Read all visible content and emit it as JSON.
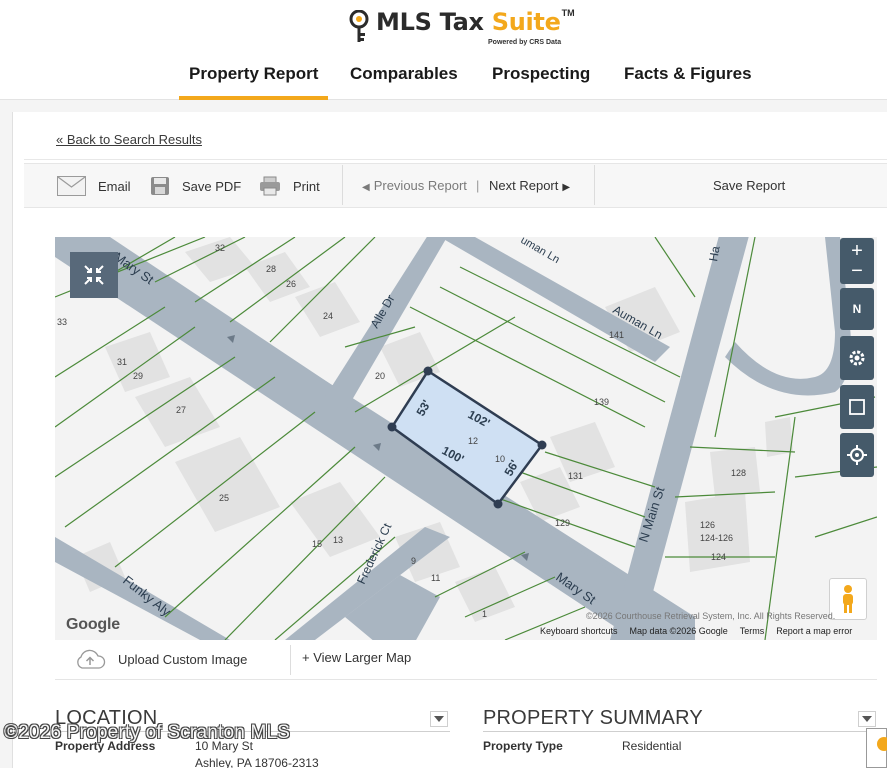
{
  "logo": {
    "brand_main": "MLS Tax ",
    "brand_accent": "Suite",
    "tm": "TM",
    "powered": "Powered by CRS Data"
  },
  "nav": {
    "tabs": [
      {
        "label": "Property Report",
        "active": true
      },
      {
        "label": "Comparables"
      },
      {
        "label": "Prospecting"
      },
      {
        "label": "Facts & Figures"
      }
    ]
  },
  "back_link": "« Back to Search Results",
  "toolbar": {
    "email": "Email",
    "save_pdf": "Save PDF",
    "print": "Print",
    "previous_report": "Previous Report",
    "next_report": "Next Report",
    "save_report": "Save Report"
  },
  "map": {
    "streets": {
      "mary_st_upper": "Mary St",
      "mary_st_lower": "Mary St",
      "alle_dr": "Alle Dr",
      "auman_ln_top": "uman Ln",
      "auman_ln": "Auman Ln",
      "n_main_st": "N Main St",
      "frederick_ct": "Frederick Ct",
      "funky_aly": "Funky Aly",
      "ha": "Ha"
    },
    "parcels": {
      "p32": "32",
      "p28": "28",
      "p26": "26",
      "p24": "24",
      "p33": "33",
      "p31": "31",
      "p29": "29",
      "p27": "27",
      "p25": "25",
      "p20": "20",
      "p12": "12",
      "p10": "10",
      "p141": "141",
      "p139": "139",
      "p131": "131",
      "p129": "129",
      "p128": "128",
      "p126": "126",
      "p124_126": "124-126",
      "p124": "124",
      "p15": "15",
      "p13": "13",
      "p9": "9",
      "p11": "11",
      "p1": "1"
    },
    "dimensions": {
      "d53": "53'",
      "d102": "102'",
      "d100": "100'",
      "d56": "56'"
    },
    "controls": {
      "zoom_in": "+",
      "zoom_out": "−",
      "compass": "N"
    },
    "google": "Google",
    "copyright": "©2026 Courthouse Retrieval System, Inc. All Rights Reserved.",
    "footer": {
      "shortcuts": "Keyboard shortcuts",
      "map_data": "Map data ©2026 Google",
      "terms": "Terms",
      "report": "Report a map error"
    },
    "upload": "Upload Custom Image",
    "view_larger": "+ View Larger Map"
  },
  "location": {
    "title": "LOCATION",
    "address_label": "Property Address",
    "address_line1": "10 Mary St",
    "address_line2": "Ashley, PA 18706-2313"
  },
  "summary": {
    "title": "PROPERTY SUMMARY",
    "type_label": "Property Type",
    "type_value": "Residential"
  },
  "watermark": "©2026 Property of Scranton MLS",
  "colors": {
    "accent": "#f3a81c",
    "road": "#a9b5c1",
    "parcel_line": "#4c8a3a",
    "subject_fill": "#cfe0f3",
    "subject_stroke": "#2f3d52",
    "map_ctrl": "#455a6a"
  }
}
